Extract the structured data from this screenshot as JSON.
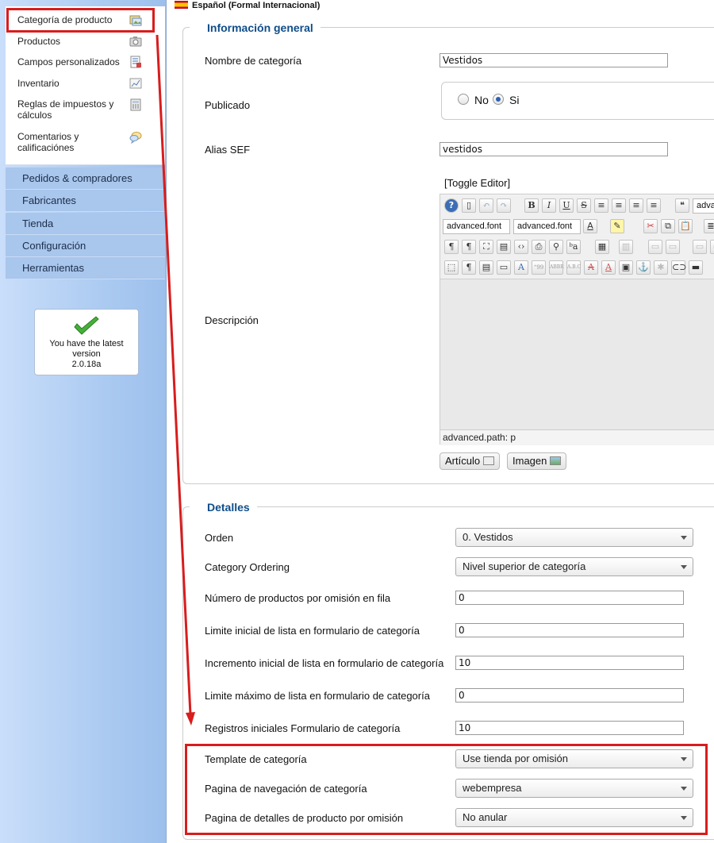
{
  "sidebar": {
    "submenu": [
      {
        "label": "Categoría de producto",
        "icon": "folder-image-icon",
        "active": true
      },
      {
        "label": "Productos",
        "icon": "camera-icon"
      },
      {
        "label": "Campos personalizados",
        "icon": "list-edit-icon"
      },
      {
        "label": "Inventario",
        "icon": "chart-icon"
      },
      {
        "label": "Reglas de impuestos y cálculos",
        "icon": "calculator-icon"
      },
      {
        "label": "Comentarios y calificaciónes",
        "icon": "speech-bubble-icon"
      }
    ],
    "menu": [
      "Pedidos & compradores",
      "Fabricantes",
      "Tienda",
      "Configuración",
      "Herramientas"
    ],
    "version": {
      "line1": "You have the latest",
      "line2": "version",
      "number": "2.0.18a"
    }
  },
  "language": "Español (Formal Internacional)",
  "general": {
    "legend": "Información general",
    "name_label": "Nombre de categoría",
    "name_value": "Vestidos",
    "published_label": "Publicado",
    "published_no": "No",
    "published_yes": "Si",
    "published_value": "Si",
    "alias_label": "Alias SEF",
    "alias_value": "vestidos",
    "description_label": "Descripción",
    "editor": {
      "toggle": "[Toggle Editor]",
      "font_select_1": "advanced.font",
      "font_select_2": "advanced.font",
      "style_select": "adva",
      "path": "advanced.path: p",
      "article_button": "Artículo",
      "image_button": "Imagen"
    }
  },
  "details": {
    "legend": "Detalles",
    "fields": [
      {
        "label": "Orden",
        "type": "select",
        "value": "0. Vestidos"
      },
      {
        "label": "Category Ordering",
        "type": "select",
        "value": "Nivel superior de categoría"
      },
      {
        "label": "Número de productos por omisión en fila",
        "type": "text",
        "value": "0"
      },
      {
        "label": "Limite inicial de lista en formulario de categoría",
        "type": "text",
        "value": "0"
      },
      {
        "label": "Incremento inicial de lista en formulario de categoría",
        "type": "text",
        "value": "10"
      },
      {
        "label": "Limite máximo de lista en formulario de categoría",
        "type": "text",
        "value": "0"
      },
      {
        "label": "Registros iniciales Formulario de categoría",
        "type": "text",
        "value": "10"
      },
      {
        "label": "Template de categoría",
        "type": "select",
        "value": "Use tienda por omisión"
      },
      {
        "label": "Pagina de navegación de categoría",
        "type": "select",
        "value": "webempresa"
      },
      {
        "label": "Pagina de detalles de producto por omisión",
        "type": "select",
        "value": "No anular"
      }
    ]
  },
  "colors": {
    "highlight": "#d81d1d",
    "legend": "#0f4d8a",
    "sidebar": "#a9c6ec"
  }
}
